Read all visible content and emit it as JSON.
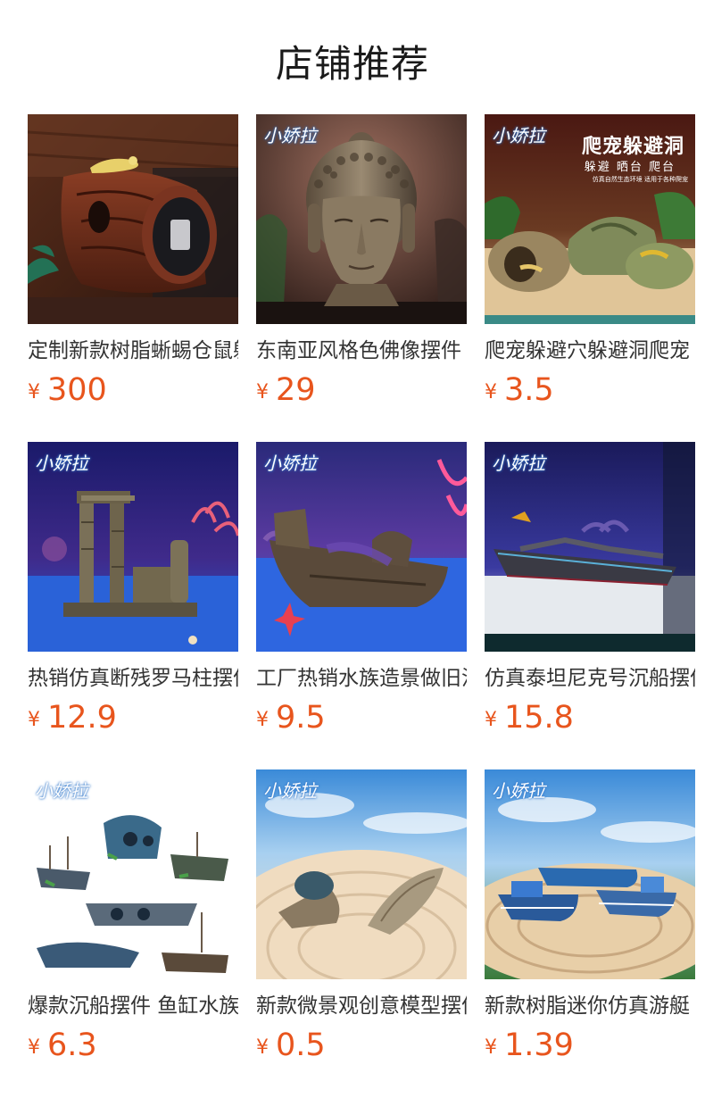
{
  "header": {
    "title": "店铺推荐"
  },
  "colors": {
    "price": "#e8551d",
    "title": "#1a1a1a"
  },
  "products": [
    {
      "name": "定制新款树脂蜥蜴仓鼠躲避洞",
      "currency": "¥",
      "price": "300",
      "image": "resin-log-hideout-with-lizard",
      "brand": ""
    },
    {
      "name": "东南亚风格色佛像摆件",
      "currency": "¥",
      "price": "29",
      "image": "buddha-head-statue",
      "brand": "小娇拉"
    },
    {
      "name": "爬宠躲避穴躲避洞爬宠",
      "currency": "¥",
      "price": "3.5",
      "image": "reptile-rock-cave",
      "brand": "小娇拉",
      "banner": {
        "title": "爬宠躲避洞",
        "subtitle": "躲避  晒台  爬台",
        "note": "仿真自然生态环境 适用于各种爬宠"
      }
    },
    {
      "name": "热销仿真断残罗马柱摆件",
      "currency": "¥",
      "price": "12.9",
      "image": "roman-column-ruins",
      "brand": "小娇拉"
    },
    {
      "name": "工厂热销水族造景做旧沉船",
      "currency": "¥",
      "price": "9.5",
      "image": "pirate-shipwreck",
      "brand": "小娇拉"
    },
    {
      "name": "仿真泰坦尼克号沉船摆件",
      "currency": "¥",
      "price": "15.8",
      "image": "titanic-shipwreck",
      "brand": "小娇拉"
    },
    {
      "name": "爆款沉船摆件 鱼缸水族",
      "currency": "¥",
      "price": "6.3",
      "image": "shipwreck-set",
      "brand": "小娇拉"
    },
    {
      "name": "新款微景观创意模型摆件",
      "currency": "¥",
      "price": "0.5",
      "image": "mini-wooden-boats",
      "brand": "小娇拉"
    },
    {
      "name": "新款树脂迷你仿真游艇",
      "currency": "¥",
      "price": "1.39",
      "image": "mini-blue-boats",
      "brand": "小娇拉"
    }
  ]
}
